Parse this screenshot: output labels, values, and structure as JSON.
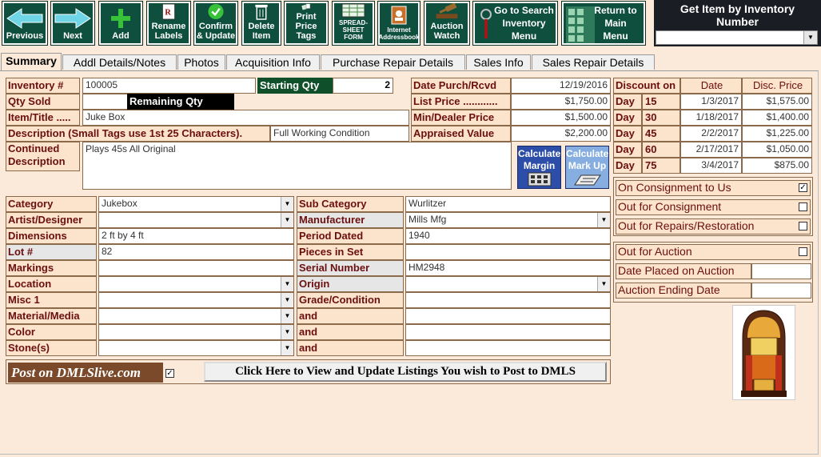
{
  "toolbar": {
    "previous": "Previous",
    "next": "Next",
    "add": "Add",
    "rename_labels": [
      "Rename",
      "Labels"
    ],
    "confirm_update": [
      "Confirm",
      "& Update"
    ],
    "delete_item": [
      "Delete",
      "Item"
    ],
    "print_price_tags": [
      "Print",
      "Price Tags"
    ],
    "spreadsheet_form": [
      "SPREAD-",
      "SHEET",
      "FORM"
    ],
    "internet_addressbook": [
      "Internet",
      "Addressbook"
    ],
    "auction_watch": [
      "Auction",
      "Watch"
    ],
    "go_to_search": [
      "Go to Search",
      "Inventory",
      "Menu"
    ],
    "return_main": [
      "Return to",
      "Main",
      "Menu"
    ]
  },
  "get_item": {
    "label": [
      "Get Item by Inventory",
      "Number"
    ],
    "value": ""
  },
  "tabs": [
    "Summary",
    "Addl Details/Notes",
    "Photos",
    "Acquisition Info",
    "Purchase Repair Details",
    "Sales Info",
    "Sales Repair Details"
  ],
  "summary": {
    "inventory_label": "Inventory #",
    "inventory_value": "100005",
    "starting_qty_label": "Starting Qty",
    "starting_qty_value": "2",
    "qty_sold_label": "Qty Sold",
    "qty_sold_value": "",
    "remaining_qty_label": "Remaining Qty",
    "item_title_label": "Item/Title .....",
    "item_title_value": "Juke Box",
    "description_label": "Description (Small Tags use 1st 25 Characters).",
    "description_value": "Full Working Condition",
    "continued_label": [
      "Continued",
      "Description"
    ],
    "continued_value": "Plays 45s All Original",
    "date_purch_label": "Date Purch/Rcvd",
    "date_purch_value": "12/19/2016",
    "list_price_label": "List  Price ............",
    "list_price_value": "$1,750.00",
    "min_dealer_label": "Min/Dealer Price",
    "min_dealer_value": "$1,500.00",
    "appraised_label": "Appraised Value",
    "appraised_value": "$2,200.00",
    "calc_margin": [
      "Calculate",
      "Margin"
    ],
    "calc_markup": [
      "Calculate",
      "Mark Up"
    ]
  },
  "discount": {
    "headers": [
      "Discount on",
      "Date",
      "Disc. Price"
    ],
    "day_label": "Day",
    "rows": [
      {
        "day": "15",
        "date": "1/3/2017",
        "price": "$1,575.00"
      },
      {
        "day": "30",
        "date": "1/18/2017",
        "price": "$1,400.00"
      },
      {
        "day": "45",
        "date": "2/2/2017",
        "price": "$1,225.00"
      },
      {
        "day": "60",
        "date": "2/17/2017",
        "price": "$1,050.00"
      },
      {
        "day": "75",
        "date": "3/4/2017",
        "price": "$875.00"
      }
    ]
  },
  "consignment": {
    "on_consignment": "On Consignment to Us",
    "on_consignment_checked": true,
    "out_consignment": "Out for Consignment",
    "out_consignment_checked": false,
    "out_repairs": "Out for Repairs/Restoration",
    "out_repairs_checked": false
  },
  "auction": {
    "out_auction": "Out for Auction",
    "out_auction_checked": false,
    "date_placed": "Date Placed on Auction",
    "date_placed_value": "",
    "ending_date": "Auction Ending Date",
    "ending_date_value": ""
  },
  "details_left": [
    {
      "label": "Category",
      "value": "Jukebox",
      "dropdown": true,
      "grey": false
    },
    {
      "label": "Artist/Designer",
      "value": "",
      "dropdown": true,
      "grey": false
    },
    {
      "label": "Dimensions",
      "value": "2 ft by 4 ft",
      "dropdown": false,
      "grey": false
    },
    {
      "label": "Lot #",
      "value": "82",
      "dropdown": false,
      "grey": true
    },
    {
      "label": "Markings",
      "value": "",
      "dropdown": false,
      "grey": false
    },
    {
      "label": "Location",
      "value": "",
      "dropdown": true,
      "grey": false
    },
    {
      "label": "Misc 1",
      "value": "",
      "dropdown": true,
      "grey": false
    },
    {
      "label": "Material/Media",
      "value": "",
      "dropdown": true,
      "grey": false
    },
    {
      "label": "Color",
      "value": "",
      "dropdown": true,
      "grey": false
    },
    {
      "label": "Stone(s)",
      "value": "",
      "dropdown": true,
      "grey": false
    }
  ],
  "details_right": [
    {
      "label": "Sub Category",
      "value": "Wurlitzer",
      "dropdown": false,
      "grey": false
    },
    {
      "label": "Manufacturer",
      "value": "Mills Mfg",
      "dropdown": true,
      "grey": true
    },
    {
      "label": "Period Dated",
      "value": "1940",
      "dropdown": false,
      "grey": false
    },
    {
      "label": "Pieces in Set",
      "value": "",
      "dropdown": false,
      "grey": false
    },
    {
      "label": "Serial Number",
      "value": "HM2948",
      "dropdown": false,
      "grey": true
    },
    {
      "label": "Origin",
      "value": "",
      "dropdown": true,
      "grey": true
    },
    {
      "label": "Grade/Condition",
      "value": "",
      "dropdown": false,
      "grey": false
    },
    {
      "label": "and",
      "value": "",
      "dropdown": false,
      "grey": false
    },
    {
      "label": "and",
      "value": "",
      "dropdown": false,
      "grey": false
    },
    {
      "label": "and",
      "value": "",
      "dropdown": false,
      "grey": false
    }
  ],
  "dmls": {
    "post_label": "Post on DMLSlive.com",
    "post_checked": true,
    "button": "Click Here to View and Update Listings You wish to Post to DMLS"
  },
  "colors": {
    "toolbar": "#0f4f3d",
    "background": "#fbe9d9",
    "label_text": "#6b0f0f",
    "accent_blue": "#2d4ea8"
  }
}
